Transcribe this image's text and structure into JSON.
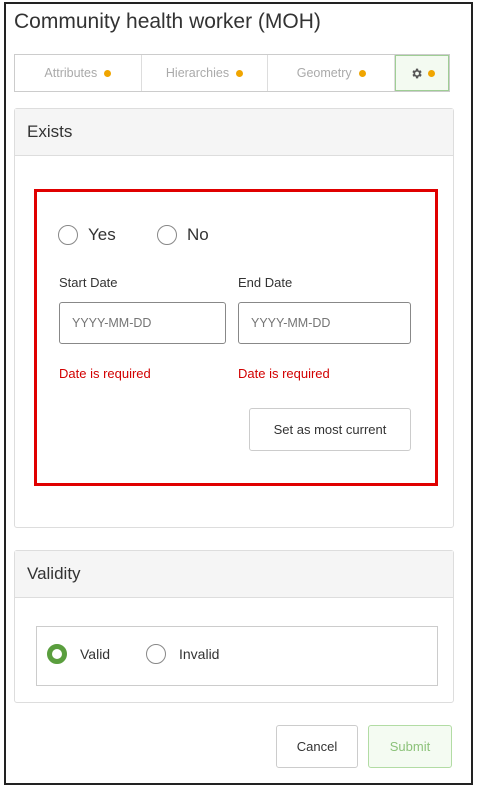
{
  "title": "Community health worker (MOH)",
  "tabs": [
    {
      "label": "Attributes"
    },
    {
      "label": "Hierarchies"
    },
    {
      "label": "Geometry"
    },
    {
      "label": ""
    }
  ],
  "exists": {
    "header": "Exists",
    "yes_label": "Yes",
    "no_label": "No",
    "start_label": "Start Date",
    "end_label": "End Date",
    "start_placeholder": "YYYY-MM-DD",
    "end_placeholder": "YYYY-MM-DD",
    "start_error": "Date is required",
    "end_error": "Date is required",
    "set_current_label": "Set as most current"
  },
  "validity": {
    "header": "Validity",
    "valid_label": "Valid",
    "invalid_label": "Invalid",
    "selected": "valid"
  },
  "footer": {
    "cancel_label": "Cancel",
    "submit_label": "Submit"
  },
  "colors": {
    "error": "#d20000",
    "highlight_border": "#e00000",
    "accent_green": "#5a9e3e",
    "dot_orange": "#f0a500"
  },
  "icons": {
    "gear": "gear-icon",
    "status_dot": "status-dot-icon"
  }
}
